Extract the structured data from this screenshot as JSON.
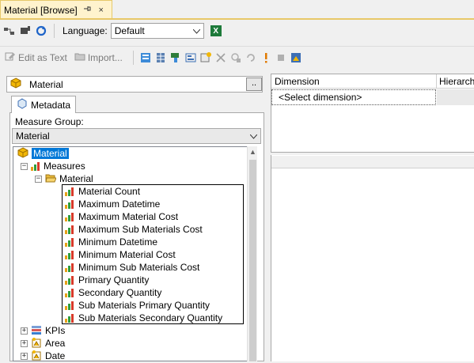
{
  "document_tab": {
    "title": "Material [Browse]",
    "pin_icon": "pin-icon",
    "close_glyph": "×"
  },
  "toolbar1": {
    "language_label": "Language:",
    "language_value": "Default",
    "excel_icon_text": "X"
  },
  "toolbar2": {
    "edit_as_text_label": "Edit as Text",
    "import_label": "Import..."
  },
  "cube_selector": {
    "name": "Material",
    "browse_button": ".."
  },
  "metadata_tab": {
    "label": "Metadata"
  },
  "measure_group": {
    "label": "Measure Group:",
    "value": "Material"
  },
  "tree": {
    "root": "Material",
    "measures_folder": "Measures",
    "material_folder": "Material",
    "measures": [
      "Material Count",
      "Maximum Datetime",
      "Maximum Material Cost",
      "Maximum Sub Materials Cost",
      "Minimum Datetime",
      "Minimum Material Cost",
      "Minimum Sub Materials Cost",
      "Primary Quantity",
      "Secondary Quantity",
      "Sub Materials Primary Quantity",
      "Sub Materials Secondary Quantity"
    ],
    "kpis": "KPIs",
    "area": "Area",
    "date": "Date"
  },
  "filter_grid": {
    "col_dimension": "Dimension",
    "col_hierarchy": "Hierarchy",
    "placeholder_row": "<Select dimension>"
  },
  "colors": {
    "tab_bg": "#fff3cd",
    "selection": "#0078d7",
    "cube_gold": "#f2b705"
  }
}
